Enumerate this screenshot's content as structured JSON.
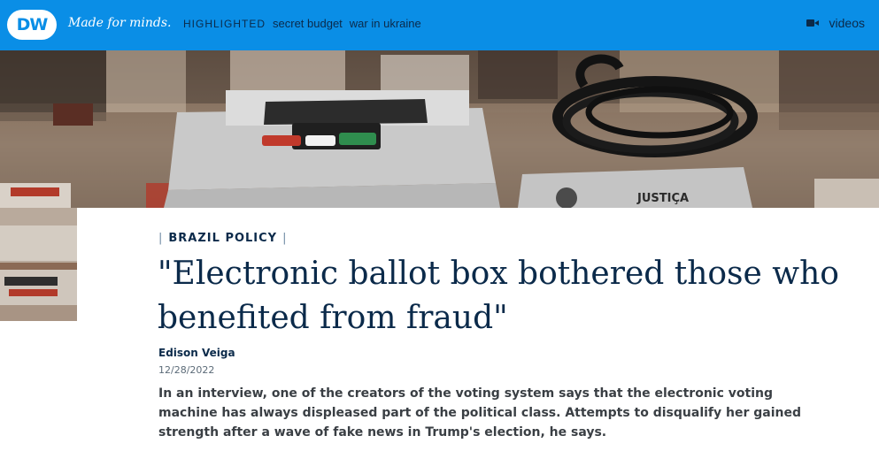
{
  "header": {
    "logo_text": "DW",
    "slogan": "Made for minds.",
    "nav_label": "HIGHLIGHTED",
    "nav_links": [
      "secret budget",
      "war in ukraine"
    ],
    "videos_label": "videos",
    "brand_color": "#0a8ee6"
  },
  "article": {
    "kicker": "BRAZIL POLICY",
    "headline": "\"Electronic ballot box bothered those who benefited from fraud\"",
    "author": "Edison Veiga",
    "date": "12/28/2022",
    "teaser": "In an interview, one of the creators of the voting system says that the electronic voting machine has always displeased part of the political class. Attempts to disqualify her gained strength after a wave of fake news in Trump's election, he says.",
    "hero_machine_label": "JUSTIÇA"
  }
}
